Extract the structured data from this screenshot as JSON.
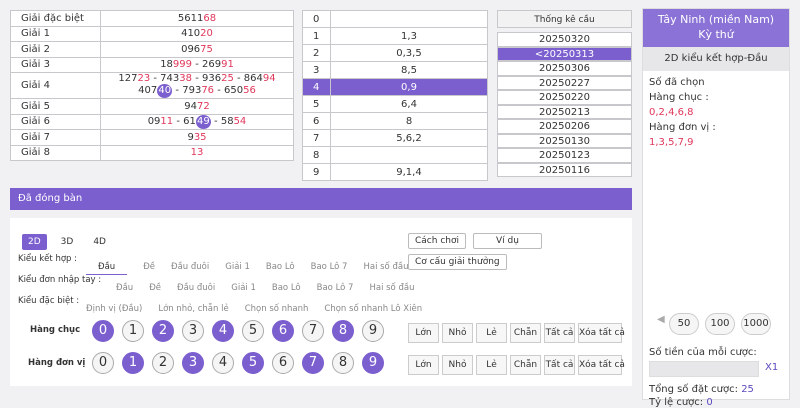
{
  "results": [
    {
      "label": "Giải đặc biệt",
      "lines": [
        [
          {
            "t": "5611"
          },
          {
            "t": "68",
            "c": "red"
          }
        ]
      ]
    },
    {
      "label": "Giải 1",
      "lines": [
        [
          {
            "t": "410"
          },
          {
            "t": "20",
            "c": "red"
          }
        ]
      ]
    },
    {
      "label": "Giải 2",
      "lines": [
        [
          {
            "t": "096"
          },
          {
            "t": "75",
            "c": "red"
          }
        ]
      ]
    },
    {
      "label": "Giải 3",
      "lines": [
        [
          {
            "t": "18"
          },
          {
            "t": "999",
            "c": "red"
          },
          {
            "t": " - 269"
          },
          {
            "t": "91",
            "c": "red"
          }
        ]
      ]
    },
    {
      "label": "Giải 4",
      "lines": [
        [
          {
            "t": "127"
          },
          {
            "t": "23",
            "c": "red"
          },
          {
            "t": " - 743"
          },
          {
            "t": "38",
            "c": "red"
          },
          {
            "t": " - 936"
          },
          {
            "t": "25",
            "c": "red"
          },
          {
            "t": " - 864"
          },
          {
            "t": "94",
            "c": "red"
          }
        ],
        [
          {
            "t": "407"
          },
          {
            "t": "40",
            "c": "hl"
          },
          {
            "t": " - 793"
          },
          {
            "t": "76",
            "c": "red"
          },
          {
            "t": " - 650"
          },
          {
            "t": "56",
            "c": "red"
          }
        ]
      ]
    },
    {
      "label": "Giải 5",
      "lines": [
        [
          {
            "t": "94"
          },
          {
            "t": "72",
            "c": "red"
          }
        ]
      ]
    },
    {
      "label": "Giải 6",
      "lines": [
        [
          {
            "t": "09"
          },
          {
            "t": "11",
            "c": "red"
          },
          {
            "t": " - 61"
          },
          {
            "t": "49",
            "c": "hl"
          },
          {
            "t": " - 58"
          },
          {
            "t": "54",
            "c": "red"
          }
        ]
      ]
    },
    {
      "label": "Giải 7",
      "lines": [
        [
          {
            "t": "9"
          },
          {
            "t": "35",
            "c": "red"
          }
        ]
      ]
    },
    {
      "label": "Giải 8",
      "lines": [
        [
          {
            "t": "13",
            "c": "red"
          }
        ]
      ]
    }
  ],
  "digits": [
    {
      "n": "0",
      "v": ""
    },
    {
      "n": "1",
      "v": "1,3"
    },
    {
      "n": "2",
      "v": "0,3,5"
    },
    {
      "n": "3",
      "v": "8,5"
    },
    {
      "n": "4",
      "v": "0,9",
      "sel": true
    },
    {
      "n": "5",
      "v": "6,4"
    },
    {
      "n": "6",
      "v": "8"
    },
    {
      "n": "7",
      "v": "5,6,2"
    },
    {
      "n": "8",
      "v": ""
    },
    {
      "n": "9",
      "v": "9,1,4"
    }
  ],
  "thongke": {
    "title": "Thống kê cầu",
    "dates": [
      "20250320",
      "<20250313",
      "20250306",
      "20250227",
      "20250220",
      "20250213",
      "20250206",
      "20250130",
      "20250123",
      "20250116"
    ],
    "selected": 1
  },
  "panel": {
    "title": "Tây Ninh (miền Nam)",
    "subtitle": "Kỳ thứ",
    "mode": "2D kiểu kết hợp-Đầu",
    "chosen_label": "Số đã chọn",
    "chuc_label": "Hàng chục :",
    "chuc_value": "0,2,4,6,8",
    "donvi_label": "Hàng đơn vị :",
    "donvi_value": "1,3,5,7,9",
    "chips": [
      "50",
      "100",
      "1000"
    ],
    "bet_label": "Số tiền của mỗi cược:",
    "multiplier": "X1",
    "total_label": "Tổng số đặt cược:",
    "total_value": "25",
    "rate_label": "Tỷ lệ cược:",
    "rate_value": "0"
  },
  "closed_bar": "Đã đóng bàn",
  "tabs": [
    "2D",
    "3D",
    "4D"
  ],
  "top_buttons": [
    "Cách chơi",
    "Ví dụ",
    "Cơ cấu giải thưởng"
  ],
  "rows": [
    {
      "label": "Kiểu kết hợp :",
      "opts": [
        "Đầu",
        "Đề",
        "Đầu đuôi",
        "Giải 1",
        "Bao Lô",
        "Bao Lô 7",
        "Hai số đầu"
      ],
      "on": 0
    },
    {
      "label": "Kiểu đơn nhập tay :",
      "opts": [
        "Đầu",
        "Đề",
        "Đầu đuôi",
        "Giải 1",
        "Bao Lô",
        "Bao Lô 7",
        "Hai số đầu"
      ],
      "on": -1
    },
    {
      "label": "Kiểu đặc biệt :",
      "opts": [
        "Định vị (Đầu)",
        "Lớn nhỏ, chẵn lẻ",
        "Chọn số nhanh",
        "Chọn số nhanh Lô Xiên"
      ],
      "on": -1
    }
  ],
  "balls": {
    "chuc_label": "Hàng chục",
    "donvi_label": "Hàng đơn vị",
    "chuc_on": [
      0,
      2,
      4,
      6,
      8
    ],
    "donvi_on": [
      1,
      3,
      5,
      7,
      9
    ],
    "quick": [
      "Lớn",
      "Nhỏ",
      "Lẻ",
      "Chẵn",
      "Tất cả",
      "Xóa tất cả"
    ]
  }
}
